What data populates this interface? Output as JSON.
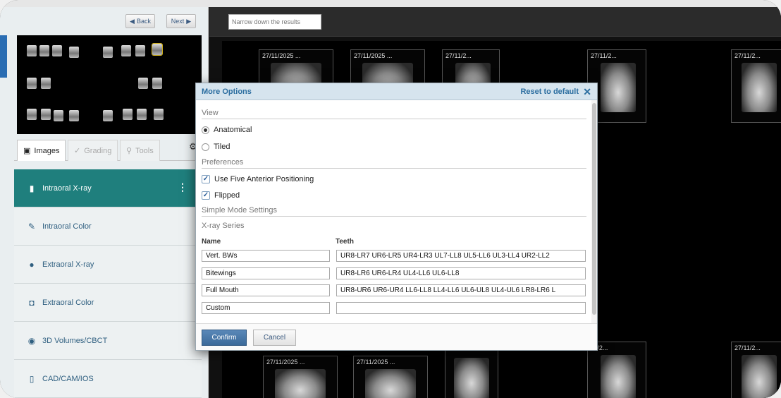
{
  "nav": {
    "back_label": "Back",
    "next_label": "Next"
  },
  "tabs": [
    {
      "label": "Images",
      "icon": "image-icon"
    },
    {
      "label": "Grading",
      "icon": "check-icon"
    },
    {
      "label": "Tools",
      "icon": "wrench-icon"
    }
  ],
  "categories": [
    {
      "label": "Intraoral X-ray",
      "icon": "tooth-icon",
      "active": true
    },
    {
      "label": "Intraoral Color",
      "icon": "brush-icon"
    },
    {
      "label": "Extraoral X-ray",
      "icon": "head-icon"
    },
    {
      "label": "Extraoral Color",
      "icon": "camera-icon"
    },
    {
      "label": "3D Volumes/CBCT",
      "icon": "skull-icon"
    },
    {
      "label": "CAD/CAM/IOS",
      "icon": "tooth-outline-icon"
    }
  ],
  "filter": {
    "placeholder": "Narrow down the results"
  },
  "cards": [
    {
      "date": "27/11/2025 ..."
    },
    {
      "date": "27/11/2025 ..."
    },
    {
      "date": "27/11/2..."
    },
    {
      "date": "27/11/2..."
    },
    {
      "date": "27/11/2..."
    },
    {
      "date": "27/11/2025 ..."
    },
    {
      "date": "27/11/2025 ..."
    },
    {
      "date": ""
    },
    {
      "date": "11/2..."
    },
    {
      "date": "27/11/2..."
    }
  ],
  "modal": {
    "title": "More Options",
    "reset_label": "Reset to default",
    "view_section": "View",
    "opt_anatomical": "Anatomical",
    "opt_tiled": "Tiled",
    "preferences_section": "Preferences",
    "opt_five_anterior": "Use Five Anterior Positioning",
    "opt_flipped": "Flipped",
    "simple_mode_section": "Simple Mode Settings",
    "xray_series_section": "X-ray Series",
    "col_name": "Name",
    "col_teeth": "Teeth",
    "series": [
      {
        "name": "Vert. BWs",
        "teeth": "UR8-LR7 UR6-LR5 UR4-LR3 UL7-LL8 UL5-LL6 UL3-LL4 UR2-LL2"
      },
      {
        "name": "Bitewings",
        "teeth": "UR8-LR6 UR6-LR4 UL4-LL6 UL6-LL8"
      },
      {
        "name": "Full Mouth",
        "teeth": "UR8-UR6 UR6-UR4 LL6-LL8 LL4-LL6 UL6-UL8 UL4-UL6 LR8-LR6 L"
      },
      {
        "name": "Custom",
        "teeth": ""
      }
    ],
    "confirm_label": "Confirm",
    "cancel_label": "Cancel"
  },
  "colors": {
    "accent_teal": "#1f7f7d",
    "link_blue": "#2c6ea0",
    "modal_header": "#d6e4ee"
  }
}
